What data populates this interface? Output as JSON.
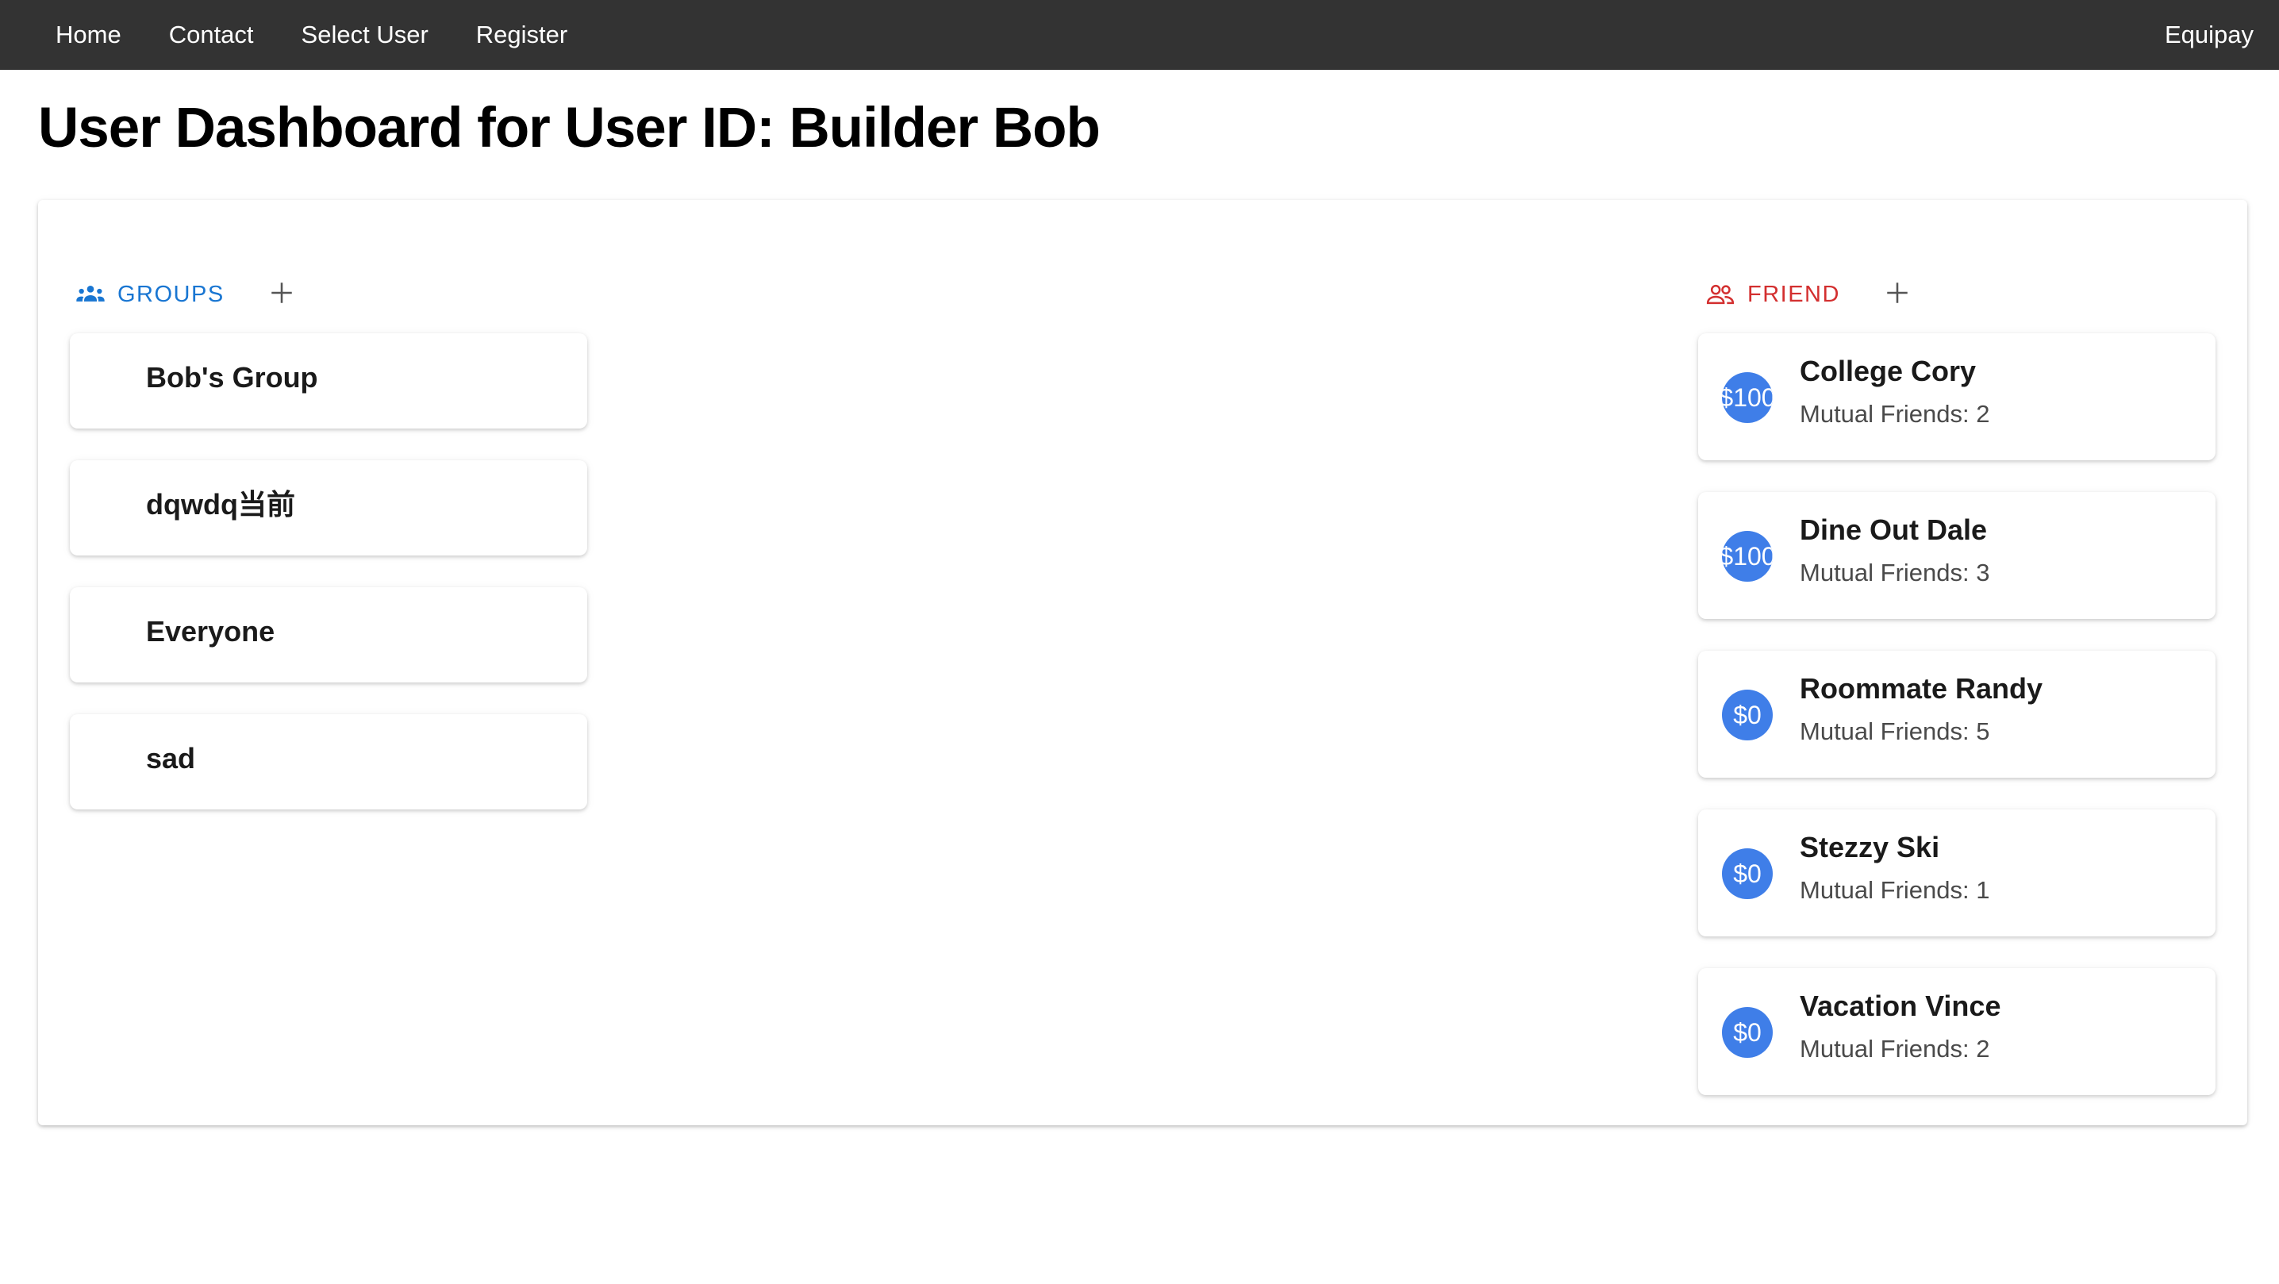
{
  "nav": {
    "links": [
      "Home",
      "Contact",
      "Select User",
      "Register"
    ],
    "brand": "Equipay"
  },
  "page_title": "User Dashboard for User ID: Builder Bob",
  "groups": {
    "label": "GROUPS",
    "icon": "groups-icon",
    "add_icon": "plus-icon",
    "accent_color": "#1976d2",
    "items": [
      "Bob's Group",
      "dqwdq当前",
      "Everyone",
      "sad"
    ]
  },
  "friends": {
    "label": "FRIEND",
    "icon": "people-outline-icon",
    "add_icon": "plus-icon",
    "accent_color": "#d32f2f",
    "avatar_color": "#3f7ee8",
    "items": [
      {
        "balance": "$100",
        "name": "College Cory",
        "mutual": "Mutual Friends: 2"
      },
      {
        "balance": "$100",
        "name": "Dine Out Dale",
        "mutual": "Mutual Friends: 3"
      },
      {
        "balance": "$0",
        "name": "Roommate Randy",
        "mutual": "Mutual Friends: 5"
      },
      {
        "balance": "$0",
        "name": "Stezzy Ski",
        "mutual": "Mutual Friends: 1"
      },
      {
        "balance": "$0",
        "name": "Vacation Vince",
        "mutual": "Mutual Friends: 2"
      }
    ]
  }
}
